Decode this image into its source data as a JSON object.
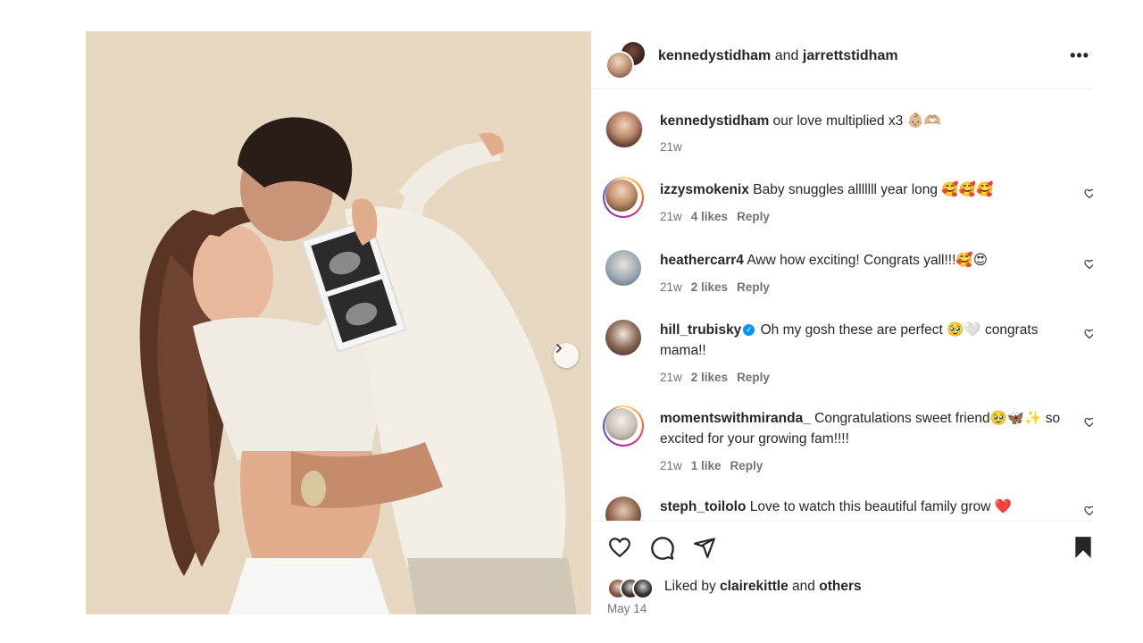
{
  "post": {
    "author_1": "kennedystidham",
    "joiner": "and",
    "author_2": "jarrettstidham",
    "more_icon": "•••"
  },
  "comments": [
    {
      "user": "kennedystidham",
      "text": "our love multiplied x3 👶🏼🫶🏼",
      "time": "21w",
      "likes": "",
      "reply": ""
    },
    {
      "user": "izzysmokenix",
      "text": "Baby snuggles alllllll year long 🥰🥰🥰",
      "time": "21w",
      "likes": "4 likes",
      "reply": "Reply"
    },
    {
      "user": "heathercarr4",
      "text": "Aww how exciting! Congrats yall!!!🥰😍",
      "time": "21w",
      "likes": "2 likes",
      "reply": "Reply"
    },
    {
      "user": "hill_trubisky",
      "text": "Oh my gosh these are perfect 🥹🤍 congrats mama!!",
      "time": "21w",
      "likes": "2 likes",
      "reply": "Reply",
      "verified": true
    },
    {
      "user": "momentswithmiranda_",
      "text": "Congratulations sweet friend🥹🦋✨ so excited for your growing fam!!!!",
      "time": "21w",
      "likes": "1 like",
      "reply": "Reply"
    },
    {
      "user": "steph_toilolo",
      "text": "Love to watch this beautiful family grow ❤️",
      "time": "",
      "likes": "",
      "reply": ""
    }
  ],
  "liked_by": {
    "prefix": "Liked by",
    "user": "clairekittle",
    "joiner": "and",
    "others": "others"
  },
  "date": "May 14",
  "colors": {
    "verified": "#0095f6",
    "secondary_text": "#737373",
    "primary_text": "#262626"
  }
}
